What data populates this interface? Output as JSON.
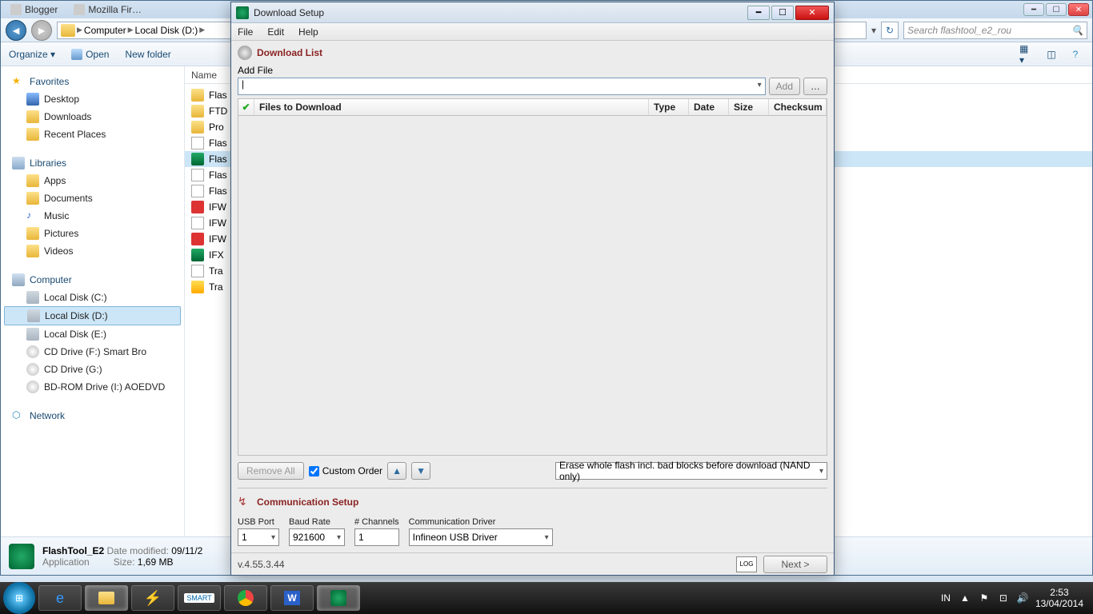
{
  "explorer": {
    "tabs": [
      {
        "label": "Blogger"
      },
      {
        "label": "Mozilla Fir…"
      }
    ],
    "breadcrumb": [
      "Computer",
      "Local Disk (D:)"
    ],
    "search_placeholder": "Search flashtool_e2_rou",
    "toolbar": {
      "organize": "Organize ▾",
      "open": "Open",
      "new_folder": "New folder"
    },
    "sidebar": {
      "favorites": {
        "title": "Favorites",
        "items": [
          "Desktop",
          "Downloads",
          "Recent Places"
        ]
      },
      "libraries": {
        "title": "Libraries",
        "items": [
          "Apps",
          "Documents",
          "Music",
          "Pictures",
          "Videos"
        ]
      },
      "computer": {
        "title": "Computer",
        "items": [
          "Local Disk (C:)",
          "Local Disk (D:)",
          "Local Disk (E:)",
          "CD Drive (F:) Smart Bro",
          "CD Drive (G:)",
          "BD-ROM Drive (I:) AOEDVD"
        ]
      },
      "network": {
        "title": "Network"
      }
    },
    "file_header": "Name",
    "files": [
      {
        "name": "Flas",
        "type": "folder"
      },
      {
        "name": "FTD",
        "type": "folder"
      },
      {
        "name": "Pro",
        "type": "folder"
      },
      {
        "name": "Flas",
        "type": "txt"
      },
      {
        "name": "Flas",
        "type": "exe",
        "selected": true
      },
      {
        "name": "Flas",
        "type": "txt"
      },
      {
        "name": "Flas",
        "type": "txt"
      },
      {
        "name": "IFW",
        "type": "pdf"
      },
      {
        "name": "IFW",
        "type": "txt"
      },
      {
        "name": "IFW",
        "type": "pdf"
      },
      {
        "name": "IFX",
        "type": "exe"
      },
      {
        "name": "Tra",
        "type": "txt"
      },
      {
        "name": "Tra",
        "type": "cfg"
      }
    ],
    "details": {
      "name": "FlashTool_E2",
      "type": "Application",
      "date_label": "Date modified:",
      "date": "09/11/2",
      "size_label": "Size:",
      "size": "1,69 MB"
    }
  },
  "dialog": {
    "title": "Download Setup",
    "menus": [
      "File",
      "Edit",
      "Help"
    ],
    "download_list": "Download List",
    "add_file_label": "Add File",
    "add_btn": "Add",
    "browse_btn": "…",
    "table": {
      "cols": [
        "Files to Download",
        "Type",
        "Date",
        "Size",
        "Checksum"
      ]
    },
    "remove_all": "Remove All",
    "custom_order": "Custom Order",
    "erase_option": "Erase whole flash incl. bad blocks before download (NAND only)",
    "comm_setup": "Communication Setup",
    "usb_port": {
      "label": "USB Port",
      "value": "1"
    },
    "baud_rate": {
      "label": "Baud Rate",
      "value": "921600"
    },
    "channels": {
      "label": "# Channels",
      "value": "1"
    },
    "comm_driver": {
      "label": "Communication Driver",
      "value": "Infineon USB Driver"
    },
    "version": "v.4.55.3.44",
    "log_btn": "LOG",
    "next_btn": "Next >"
  },
  "taskbar": {
    "lang": "IN",
    "time": "2:53",
    "date": "13/04/2014"
  }
}
